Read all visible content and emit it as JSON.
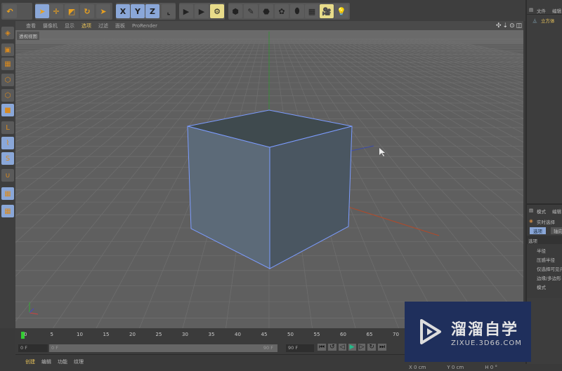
{
  "toolbar": {
    "tools": [
      {
        "icon": "undo-icon",
        "glyph": "↶"
      },
      {
        "icon": "live-select-icon",
        "glyph": "➤"
      },
      {
        "icon": "move-icon",
        "glyph": "✛"
      },
      {
        "icon": "scale-icon",
        "glyph": "◩"
      },
      {
        "icon": "rotate-icon",
        "glyph": "↻"
      },
      {
        "icon": "last-tool-icon",
        "glyph": "➤"
      },
      {
        "icon": "x-axis-lock-icon",
        "glyph": "X"
      },
      {
        "icon": "y-axis-lock-icon",
        "glyph": "Y"
      },
      {
        "icon": "z-axis-lock-icon",
        "glyph": "Z"
      },
      {
        "icon": "coordinate-system-icon",
        "glyph": "⌞"
      },
      {
        "icon": "render-view-icon",
        "glyph": "▶"
      },
      {
        "icon": "render-picture-viewer-icon",
        "glyph": "▶"
      },
      {
        "icon": "render-settings-icon",
        "glyph": "⚙"
      },
      {
        "icon": "cube-object-icon",
        "glyph": "⬢"
      },
      {
        "icon": "spline-pen-icon",
        "glyph": "✎"
      },
      {
        "icon": "subdivision-surface-icon",
        "glyph": "⬣"
      },
      {
        "icon": "array-icon",
        "glyph": "✿"
      },
      {
        "icon": "deformer-icon",
        "glyph": "⬮"
      },
      {
        "icon": "floor-icon",
        "glyph": "▦"
      },
      {
        "icon": "camera-icon",
        "glyph": "🎥"
      },
      {
        "icon": "light-icon",
        "glyph": "💡"
      }
    ]
  },
  "viewport": {
    "menu": [
      "查看",
      "摄像机",
      "显示",
      "选项",
      "过滤",
      "面板",
      "ProRender"
    ],
    "selected_menu": "选项",
    "label": "透视视图"
  },
  "left_tools": [
    "make-editable-icon",
    "texture-mode-icon",
    "workplane-icon",
    "points-mode-icon",
    "edges-mode-icon",
    "polygons-mode-icon",
    "axis-mode-icon",
    "tweak-mode-icon",
    "solo-icon",
    "snap-icon",
    "lock-workplane-icon",
    "planar-workplane-icon"
  ],
  "object_manager": {
    "menu": [
      "文件",
      "编辑"
    ],
    "objects": [
      {
        "name": "立方体"
      }
    ]
  },
  "attributes": {
    "menu": [
      "模式",
      "编辑"
    ],
    "tool": "实时选择",
    "tabs": [
      "选项",
      "轴向"
    ],
    "section": "选项",
    "fields": [
      "半径",
      "压感半径",
      "仅选择可见元",
      "边缘/多边形",
      "模式"
    ]
  },
  "timeline": {
    "ticks": [
      "0",
      "5",
      "10",
      "15",
      "20",
      "25",
      "30",
      "35",
      "40",
      "45",
      "50",
      "55",
      "60",
      "65",
      "70"
    ],
    "current_frame": "0 F",
    "range_start": "0 F",
    "range_end": "90 F",
    "end_frame": "90 F"
  },
  "material_menu": [
    "创建",
    "编辑",
    "功能",
    "纹理"
  ],
  "coordinates": {
    "x": "0 cm",
    "y": "0 cm",
    "h": "0 °"
  },
  "watermark": {
    "title": "溜溜自学",
    "url": "ZIXUE.3D66.COM"
  },
  "colors": {
    "accent": "#e8c35a",
    "selected_tool": "#8aa7d8",
    "cube": "#4d5b6b",
    "cube_edge": "#7c9cff"
  }
}
